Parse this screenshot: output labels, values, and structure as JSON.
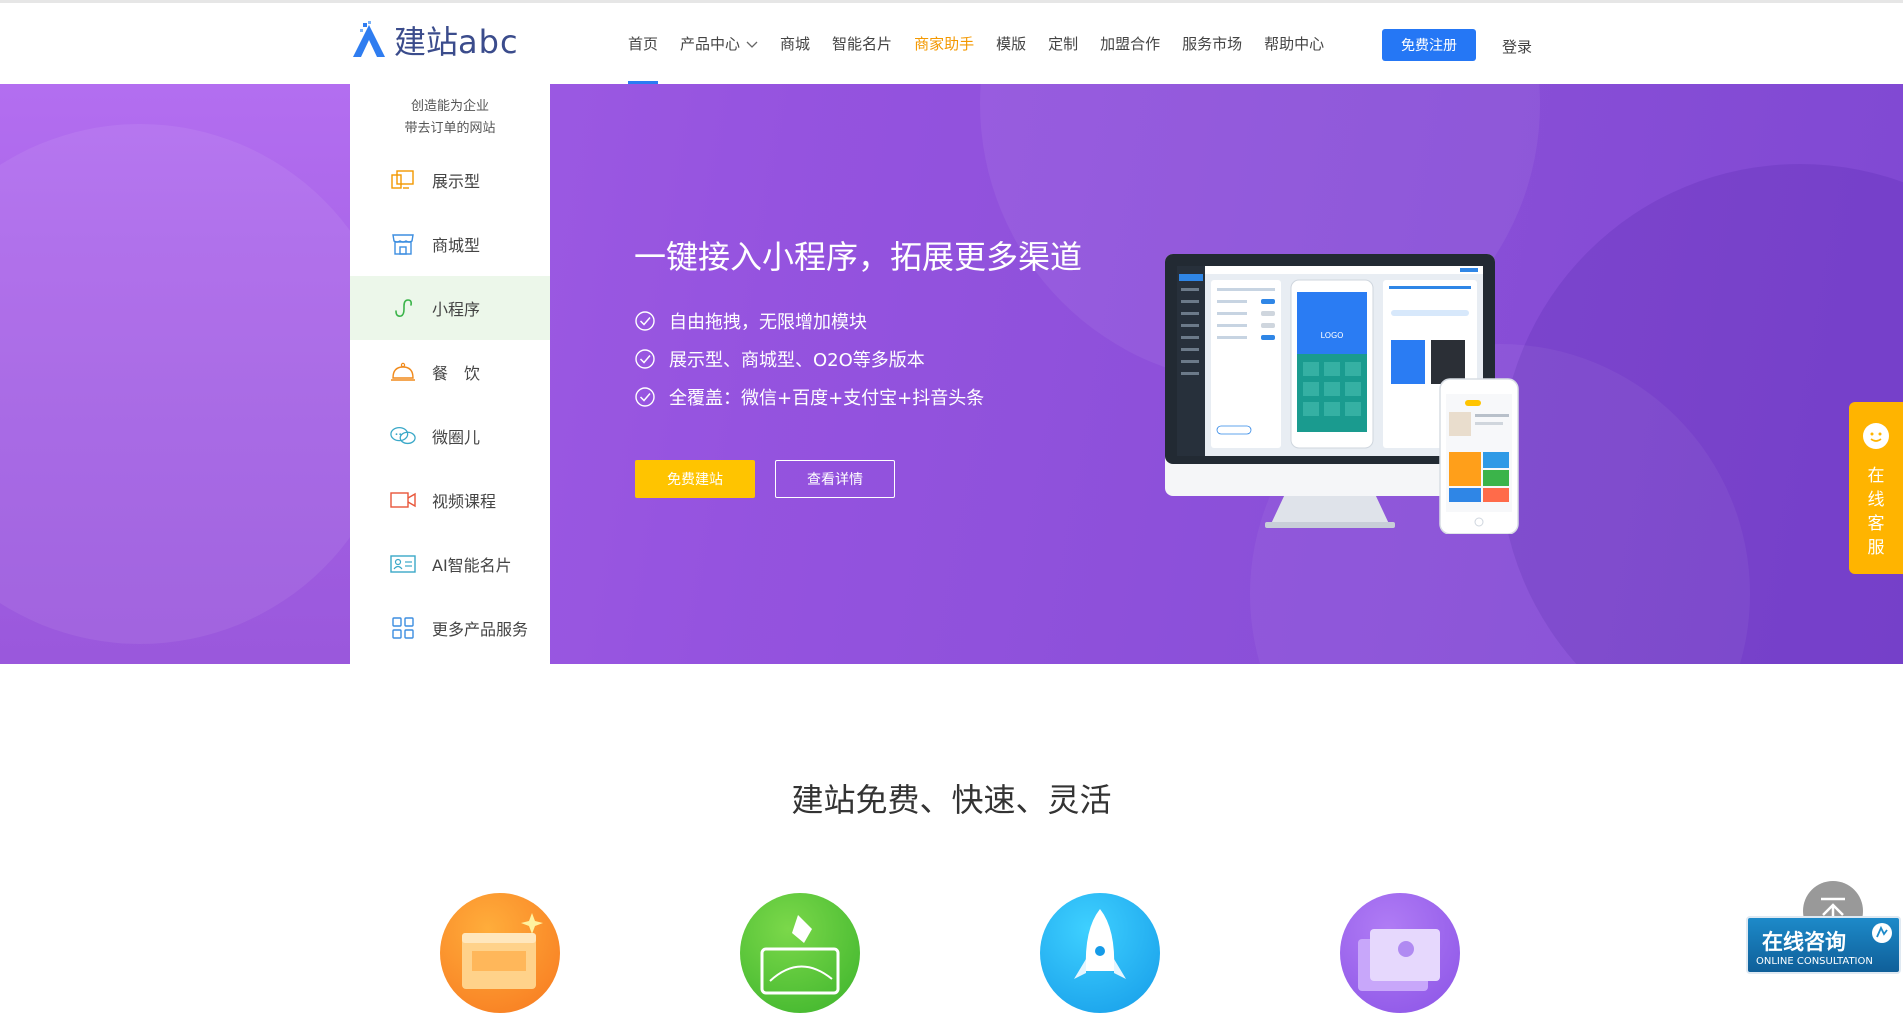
{
  "header": {
    "logo_text_cn": "建站",
    "logo_text_en": "abc",
    "nav": [
      {
        "label": "首页"
      },
      {
        "label": "产品中心"
      },
      {
        "label": "商城"
      },
      {
        "label": "智能名片"
      },
      {
        "label": "商家助手"
      },
      {
        "label": "模版"
      },
      {
        "label": "定制"
      },
      {
        "label": "加盟合作"
      },
      {
        "label": "服务市场"
      },
      {
        "label": "帮助中心"
      }
    ],
    "register_label": "免费注册",
    "login_label": "登录"
  },
  "sidemenu": {
    "slogan_line1": "创造能为企业",
    "slogan_line2": "带去订单的网站",
    "items": [
      {
        "label": "展示型",
        "icon": "display-icon"
      },
      {
        "label": "商城型",
        "icon": "store-icon"
      },
      {
        "label": "小程序",
        "icon": "miniprogram-icon"
      },
      {
        "label": "餐　饮",
        "icon": "dish-icon"
      },
      {
        "label": "微圈儿",
        "icon": "chat-icon"
      },
      {
        "label": "视频课程",
        "icon": "video-icon"
      },
      {
        "label": "AI智能名片",
        "icon": "card-icon"
      },
      {
        "label": "更多产品服务",
        "icon": "grid-icon"
      }
    ]
  },
  "hero": {
    "title": "一键接入小程序，拓展更多渠道",
    "features": [
      "自由拖拽，无限增加模块",
      "展示型、商城型、O2O等多版本",
      "全覆盖：微信+百度+支付宝+抖音头条"
    ],
    "btn_free": "免费建站",
    "btn_detail": "查看详情",
    "device_logo": "LOGO"
  },
  "float_service": {
    "chars": [
      "在",
      "线",
      "客",
      "服"
    ]
  },
  "section": {
    "title": "建站免费、快速、灵活"
  },
  "consult": {
    "zh": "在线咨询",
    "en": "ONLINE CONSULTATION"
  },
  "colors": {
    "accent_blue": "#2577f5",
    "highlight_orange": "#f39800",
    "hero_purple": "#9553df",
    "cta_yellow": "#ffc400"
  }
}
